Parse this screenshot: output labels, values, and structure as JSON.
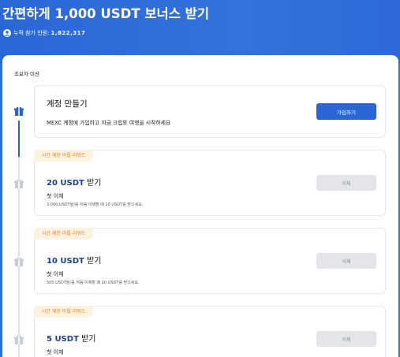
{
  "hero": {
    "title": "간편하게 1,000 USDT 보너스 받기",
    "participants_label": "누적 참가 인원:",
    "participants_count": "1,822,317"
  },
  "section": {
    "title": "초보자 미션"
  },
  "missions": [
    {
      "title": "계정 만들기",
      "description": "MEXC 계정에 가입하고 지금 크립토 여행을 시작하세요",
      "button_label": "가입하기"
    },
    {
      "tag": "시간 제한 마틀 리워드",
      "amount": "20 USDT",
      "suffix": " 받기",
      "subtitle": "첫 이체",
      "hint": "3,000 USDT을/를 처음 이체할 때 20 USDT를 받으세요.",
      "button_label": "이체"
    },
    {
      "tag": "시간 제한 마틀 리워드",
      "amount": "10 USDT",
      "suffix": " 받기",
      "subtitle": "첫 이체",
      "hint": "500 USDT을/를 처음 이체할 때 10 USDT를 받으세요.",
      "button_label": "이체"
    },
    {
      "tag": "시간 제한 마틀 리워드",
      "amount": "5 USDT",
      "suffix": " 받기",
      "subtitle": "첫 이체",
      "button_label": "이체"
    }
  ],
  "colors": {
    "hero_blue": "#2f6fd8",
    "primary_button": "#2b66d4",
    "tag_text": "#e08a1c",
    "tag_bg": "#fdf1df",
    "amount_text": "#1f3f8c"
  },
  "icons": {
    "user": "user-icon",
    "timeline_active": "gift-icon-active",
    "timeline_inactive": "gift-icon-inactive"
  }
}
